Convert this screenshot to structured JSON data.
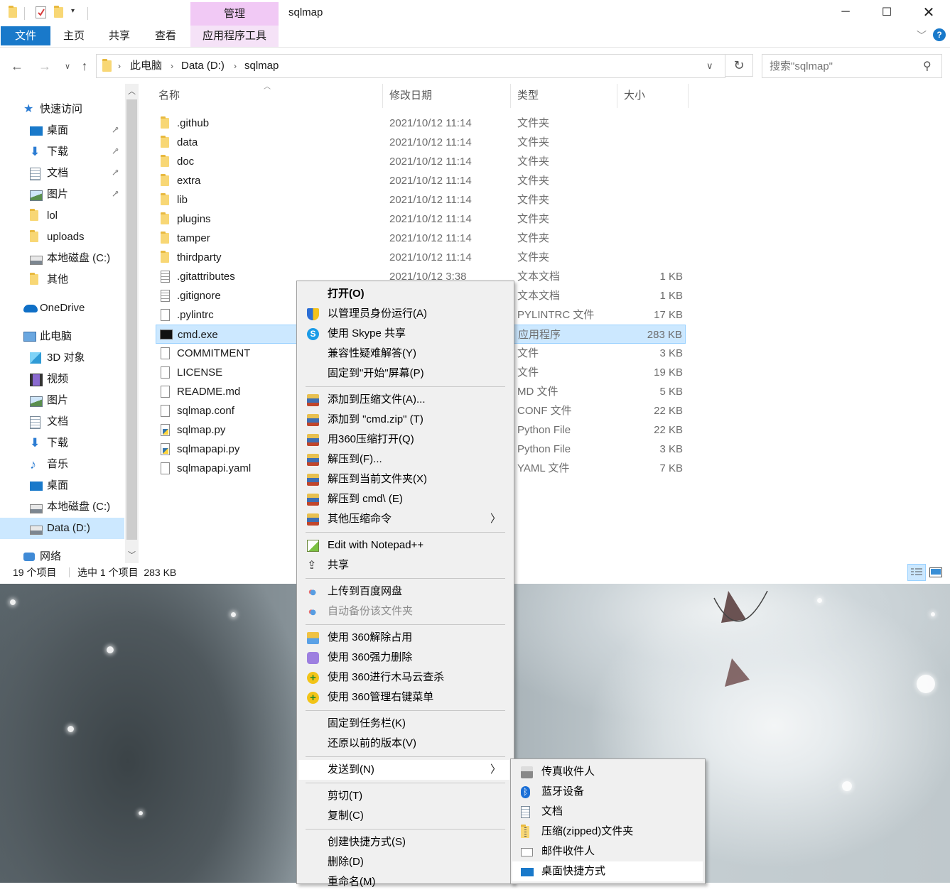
{
  "window": {
    "title": "sqlmap",
    "context_tab": "管理",
    "ribbon_tabs": [
      "文件",
      "主页",
      "共享",
      "查看",
      "应用程序工具"
    ]
  },
  "address": {
    "breadcrumbs": [
      "此电脑",
      "Data (D:)",
      "sqlmap"
    ],
    "search_placeholder": "搜索\"sqlmap\""
  },
  "nav": {
    "items": [
      {
        "label": "快速访问",
        "icon": "star-icon",
        "pinned": false
      },
      {
        "label": "桌面",
        "icon": "desktop-icon",
        "pinned": true
      },
      {
        "label": "下载",
        "icon": "download-icon",
        "pinned": true
      },
      {
        "label": "文档",
        "icon": "documents-icon",
        "pinned": true
      },
      {
        "label": "图片",
        "icon": "pictures-icon",
        "pinned": true
      },
      {
        "label": "lol",
        "icon": "folder-icon",
        "pinned": false
      },
      {
        "label": "uploads",
        "icon": "folder-icon",
        "pinned": false
      },
      {
        "label": "本地磁盘 (C:)",
        "icon": "drive-icon",
        "pinned": false
      },
      {
        "label": "其他",
        "icon": "folder-icon",
        "pinned": false
      },
      {
        "label": "OneDrive",
        "icon": "cloud-icon",
        "pinned": false
      },
      {
        "label": "此电脑",
        "icon": "computer-icon",
        "pinned": false
      },
      {
        "label": "3D 对象",
        "icon": "cube-icon",
        "pinned": false
      },
      {
        "label": "视频",
        "icon": "video-icon",
        "pinned": false
      },
      {
        "label": "图片",
        "icon": "pictures-icon",
        "pinned": false
      },
      {
        "label": "文档",
        "icon": "documents-icon",
        "pinned": false
      },
      {
        "label": "下载",
        "icon": "download-icon",
        "pinned": false
      },
      {
        "label": "音乐",
        "icon": "music-icon",
        "pinned": false
      },
      {
        "label": "桌面",
        "icon": "desktop-icon",
        "pinned": false
      },
      {
        "label": "本地磁盘 (C:)",
        "icon": "drive-icon",
        "pinned": false
      },
      {
        "label": "Data (D:)",
        "icon": "drive-icon",
        "pinned": false,
        "selected": true
      },
      {
        "label": "网络",
        "icon": "network-icon",
        "pinned": false
      }
    ]
  },
  "columns": {
    "name": "名称",
    "date": "修改日期",
    "type": "类型",
    "size": "大小"
  },
  "files": [
    {
      "name": ".github",
      "date": "2021/10/12 11:14",
      "type": "文件夹",
      "size": "",
      "kind": "folder"
    },
    {
      "name": "data",
      "date": "2021/10/12 11:14",
      "type": "文件夹",
      "size": "",
      "kind": "folder"
    },
    {
      "name": "doc",
      "date": "2021/10/12 11:14",
      "type": "文件夹",
      "size": "",
      "kind": "folder"
    },
    {
      "name": "extra",
      "date": "2021/10/12 11:14",
      "type": "文件夹",
      "size": "",
      "kind": "folder"
    },
    {
      "name": "lib",
      "date": "2021/10/12 11:14",
      "type": "文件夹",
      "size": "",
      "kind": "folder"
    },
    {
      "name": "plugins",
      "date": "2021/10/12 11:14",
      "type": "文件夹",
      "size": "",
      "kind": "folder"
    },
    {
      "name": "tamper",
      "date": "2021/10/12 11:14",
      "type": "文件夹",
      "size": "",
      "kind": "folder"
    },
    {
      "name": "thirdparty",
      "date": "2021/10/12 11:14",
      "type": "文件夹",
      "size": "",
      "kind": "folder"
    },
    {
      "name": ".gitattributes",
      "date": "2021/10/12 3:38",
      "type": "文本文档",
      "size": "1 KB",
      "kind": "text"
    },
    {
      "name": ".gitignore",
      "date": "",
      "type": "文本文档",
      "size": "1 KB",
      "kind": "text"
    },
    {
      "name": ".pylintrc",
      "date": "",
      "type": "PYLINTRC 文件",
      "size": "17 KB",
      "kind": "doc"
    },
    {
      "name": "cmd.exe",
      "date": "",
      "type": "应用程序",
      "size": "283 KB",
      "kind": "exe",
      "selected": true
    },
    {
      "name": "COMMITMENT",
      "date": "",
      "type": "文件",
      "size": "3 KB",
      "kind": "doc"
    },
    {
      "name": "LICENSE",
      "date": "",
      "type": "文件",
      "size": "19 KB",
      "kind": "doc"
    },
    {
      "name": "README.md",
      "date": "",
      "type": "MD 文件",
      "size": "5 KB",
      "kind": "doc"
    },
    {
      "name": "sqlmap.conf",
      "date": "",
      "type": "CONF 文件",
      "size": "22 KB",
      "kind": "doc"
    },
    {
      "name": "sqlmap.py",
      "date": "",
      "type": "Python File",
      "size": "22 KB",
      "kind": "py"
    },
    {
      "name": "sqlmapapi.py",
      "date": "",
      "type": "Python File",
      "size": "3 KB",
      "kind": "py"
    },
    {
      "name": "sqlmapapi.yaml",
      "date": "",
      "type": "YAML 文件",
      "size": "7 KB",
      "kind": "doc"
    }
  ],
  "status": {
    "count": "19 个项目",
    "selection": "选中 1 个项目  283 KB"
  },
  "context_menu": {
    "items": [
      {
        "label": "打开(O)",
        "bold": true
      },
      {
        "label": "以管理员身份运行(A)",
        "icon": "uac-shield-icon"
      },
      {
        "label": "使用 Skype 共享",
        "icon": "skype-icon"
      },
      {
        "label": "兼容性疑难解答(Y)"
      },
      {
        "label": "固定到\"开始\"屏幕(P)"
      },
      {
        "sep": true
      },
      {
        "label": "添加到压缩文件(A)...",
        "icon": "winrar-icon"
      },
      {
        "label": "添加到 \"cmd.zip\" (T)",
        "icon": "winrar-icon"
      },
      {
        "label": "用360压缩打开(Q)",
        "icon": "winrar-icon"
      },
      {
        "label": "解压到(F)...",
        "icon": "winrar-icon"
      },
      {
        "label": "解压到当前文件夹(X)",
        "icon": "winrar-icon"
      },
      {
        "label": "解压到 cmd\\ (E)",
        "icon": "winrar-icon"
      },
      {
        "label": "其他压缩命令",
        "icon": "winrar-icon",
        "submenu": true
      },
      {
        "sep": true
      },
      {
        "label": "Edit with Notepad++",
        "icon": "notepadpp-icon"
      },
      {
        "label": "共享",
        "icon": "share-icon"
      },
      {
        "sep": true
      },
      {
        "label": "上传到百度网盘",
        "icon": "baidu-cloud-icon"
      },
      {
        "label": "自动备份该文件夹",
        "icon": "baidu-cloud-icon",
        "disabled": true
      },
      {
        "sep": true
      },
      {
        "label": "使用 360解除占用",
        "icon": "unlock-360-icon"
      },
      {
        "label": "使用 360强力删除",
        "icon": "shred-360-icon"
      },
      {
        "label": "使用 360进行木马云查杀",
        "icon": "security-360-icon"
      },
      {
        "label": "使用 360管理右键菜单",
        "icon": "security-360-icon"
      },
      {
        "sep": true
      },
      {
        "label": "固定到任务栏(K)"
      },
      {
        "label": "还原以前的版本(V)"
      },
      {
        "sep": true
      },
      {
        "label": "发送到(N)",
        "submenu": true,
        "highlighted": true
      },
      {
        "sep": true
      },
      {
        "label": "剪切(T)"
      },
      {
        "label": "复制(C)"
      },
      {
        "sep": true
      },
      {
        "label": "创建快捷方式(S)"
      },
      {
        "label": "删除(D)"
      },
      {
        "label": "重命名(M)"
      }
    ]
  },
  "send_to_menu": {
    "items": [
      {
        "label": "传真收件人",
        "icon": "fax-icon"
      },
      {
        "label": "蓝牙设备",
        "icon": "bluetooth-icon"
      },
      {
        "label": "文档",
        "icon": "documents-icon"
      },
      {
        "label": "压缩(zipped)文件夹",
        "icon": "zip-folder-icon"
      },
      {
        "label": "邮件收件人",
        "icon": "mail-icon"
      },
      {
        "label": "桌面快捷方式",
        "icon": "desktop-icon",
        "highlighted": true
      }
    ]
  }
}
